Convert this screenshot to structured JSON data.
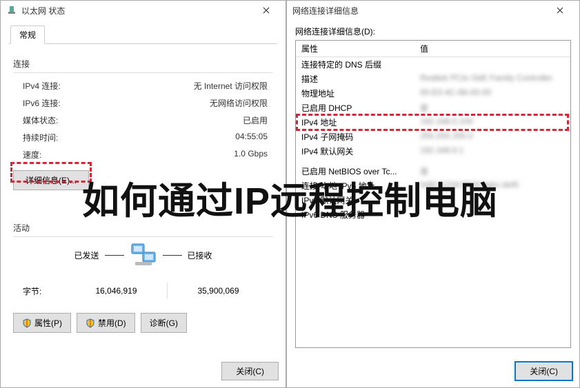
{
  "overlay_text": "如何通过IP远程控制电脑",
  "left_window": {
    "title": "以太网 状态",
    "tab": "常规",
    "connection_header": "连接",
    "rows": {
      "ipv4_conn_label": "IPv4 连接:",
      "ipv4_conn_value": "无 Internet 访问权限",
      "ipv6_conn_label": "IPv6 连接:",
      "ipv6_conn_value": "无网络访问权限",
      "media_label": "媒体状态:",
      "media_value": "已启用",
      "duration_label": "持续时间:",
      "duration_value": "04:55:05",
      "speed_label": "速度:",
      "speed_value": "1.0 Gbps"
    },
    "details_btn": "详细信息(E)...",
    "activity_header": "活动",
    "sent_label": "已发送",
    "recv_label": "已接收",
    "bytes_label": "字节:",
    "bytes_sent": "16,046,919",
    "bytes_recv": "35,900,069",
    "btn_props": "属性(P)",
    "btn_disable": "禁用(D)",
    "btn_diag": "诊断(G)",
    "btn_close": "关闭(C)"
  },
  "right_window": {
    "title": "网络连接详细信息",
    "list_label": "网络连接详细信息(D):",
    "col_property": "属性",
    "col_value": "值",
    "rows": [
      {
        "prop": "连接特定的 DNS 后缀",
        "val": ""
      },
      {
        "prop": "描述",
        "val": "Realtek PCIe GbE Family Controller",
        "blur": true
      },
      {
        "prop": "物理地址",
        "val": "00-E0-4C-68-00-00",
        "blur": true
      },
      {
        "prop": "已启用 DHCP",
        "val": "是",
        "blur": true
      },
      {
        "prop": "IPv4 地址",
        "val": "192.168.0.100",
        "blur": true,
        "highlight": true
      },
      {
        "prop": "IPv4 子网掩码",
        "val": "255.255.255.0",
        "blur": true
      },
      {
        "prop": "IPv4 默认网关",
        "val": "192.168.0.1",
        "blur": true
      },
      {
        "prop": "",
        "val": ""
      },
      {
        "prop": "",
        "val": ""
      },
      {
        "prop": "已启用 NetBIOS over Tc...",
        "val": "是",
        "blur_val_only": true
      },
      {
        "prop": "连接-本地 IPv6 地址",
        "val": "fe80::1234:5678:9abc:def0",
        "blur": true
      },
      {
        "prop": "IPv6 默认网关",
        "val": ""
      },
      {
        "prop": "IPv6 DNS 服务器",
        "val": ""
      }
    ],
    "btn_close": "关闭(C)"
  }
}
